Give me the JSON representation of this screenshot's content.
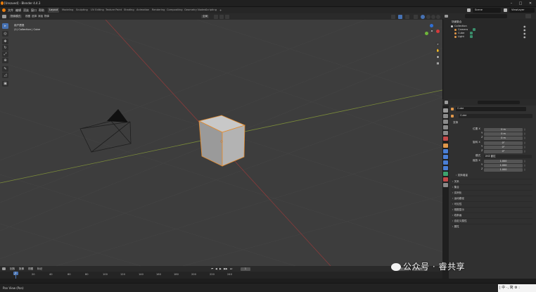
{
  "window": {
    "title": "[Unsaved] - Blender 4.4.3",
    "controls": [
      "–",
      "□",
      "✕"
    ]
  },
  "menu": {
    "items": [
      "文件",
      "编辑",
      "渲染",
      "窗口",
      "帮助"
    ],
    "workspaces": [
      "Layout",
      "Modeling",
      "Sculpting",
      "UV Editing",
      "Texture Paint",
      "Shading",
      "Animation",
      "Rendering",
      "Compositing",
      "Geometry Nodes",
      "Scripting"
    ],
    "active_workspace": "Layout",
    "scene": "Scene",
    "view_layer": "ViewLayer"
  },
  "viewport_header": {
    "mode": "物体模式",
    "menus": [
      "视图",
      "选择",
      "添加",
      "物体"
    ],
    "transform": "全局"
  },
  "viewport": {
    "view_name": "用户透视",
    "collection_info": "(1) Collection | Cube"
  },
  "toolbar": {
    "tools": [
      "select-tool",
      "cursor-tool",
      "move-tool",
      "rotate-tool",
      "scale-tool",
      "transform-tool",
      "annotate-tool",
      "measure-tool",
      "add-cube-tool"
    ]
  },
  "outliner": {
    "header": "场景集合",
    "rows": [
      {
        "label": "Collection",
        "color": "#cfcfcf"
      },
      {
        "label": "Camera",
        "color": "#e0974a"
      },
      {
        "label": "Cube",
        "color": "#e0974a"
      },
      {
        "label": "Light",
        "color": "#e0974a"
      }
    ]
  },
  "properties": {
    "object_name": "Cube",
    "panel_title": "变换",
    "location_label": "位置 X",
    "location": [
      "0 m",
      "0 m",
      "0 m"
    ],
    "rotation_label": "旋转 X",
    "rotation": [
      "0°",
      "0°",
      "0°"
    ],
    "mode_label": "模式",
    "rotation_mode": "XYZ 欧拉",
    "scale_label": "缩放 X",
    "scale": [
      "1.000",
      "1.000",
      "1.000"
    ],
    "axis_y": "Y",
    "axis_z": "Z",
    "delta": "› 变换增量",
    "collapsed_panels": [
      "› 关系",
      "› 集合",
      "› 实例化",
      "› 运动路径",
      "› 可见性",
      "› 视图显示",
      "› 线条画",
      "› 自定义属性",
      "› 属性"
    ],
    "accent_color": "#4772b3"
  },
  "timeline": {
    "menus": [
      "回放",
      "抠像",
      "视图",
      "标记"
    ],
    "current_frame": "1",
    "ticks": [
      "0",
      "20",
      "40",
      "60",
      "80",
      "100",
      "120",
      "140",
      "160",
      "180",
      "200",
      "220",
      "240"
    ],
    "start": "1",
    "end": "250"
  },
  "statusbar": {
    "text": "Pan View (Pan)"
  },
  "watermark": {
    "text": "公众号 · 睿共享"
  },
  "ime": {
    "text": "| 中 ·, 简 ⚙ :"
  }
}
